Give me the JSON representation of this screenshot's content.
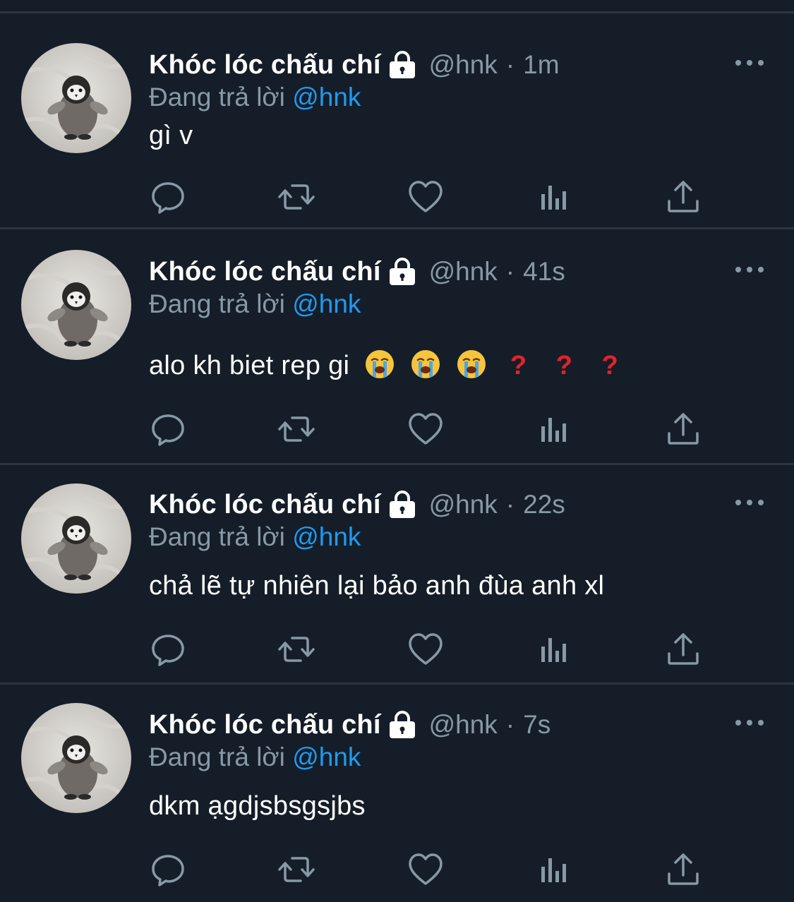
{
  "account": {
    "display_name": "Khóc lóc chấu chí",
    "handle": "@hnk",
    "avatar_icon": "penguin-plush-avatar",
    "protected_icon": "lock-icon"
  },
  "reply_prefix": "Đang trả lời",
  "reply_to": "@hnk",
  "separator": "·",
  "colors": {
    "background": "#151d28",
    "divider": "#2c3640",
    "secondary_text": "#8899a6",
    "mention": "#1d9bf0",
    "question_mark": "#e0242a"
  },
  "tweets": [
    {
      "time": "1m",
      "text": "gì v",
      "emojis": [],
      "marks": []
    },
    {
      "time": "41s",
      "text": "alo kh biet rep gi",
      "emojis": [
        "loudly-crying-face",
        "loudly-crying-face",
        "loudly-crying-face"
      ],
      "marks": [
        "?",
        "?",
        "?"
      ]
    },
    {
      "time": "22s",
      "text": "chả lẽ tự nhiên lại bảo anh đùa anh xl",
      "emojis": [],
      "marks": []
    },
    {
      "time": "7s",
      "text": "dkm ạgdjsbsgsjbs",
      "emojis": [],
      "marks": []
    }
  ],
  "action_icons": [
    "reply-icon",
    "retweet-icon",
    "like-icon",
    "analytics-icon",
    "share-icon"
  ]
}
